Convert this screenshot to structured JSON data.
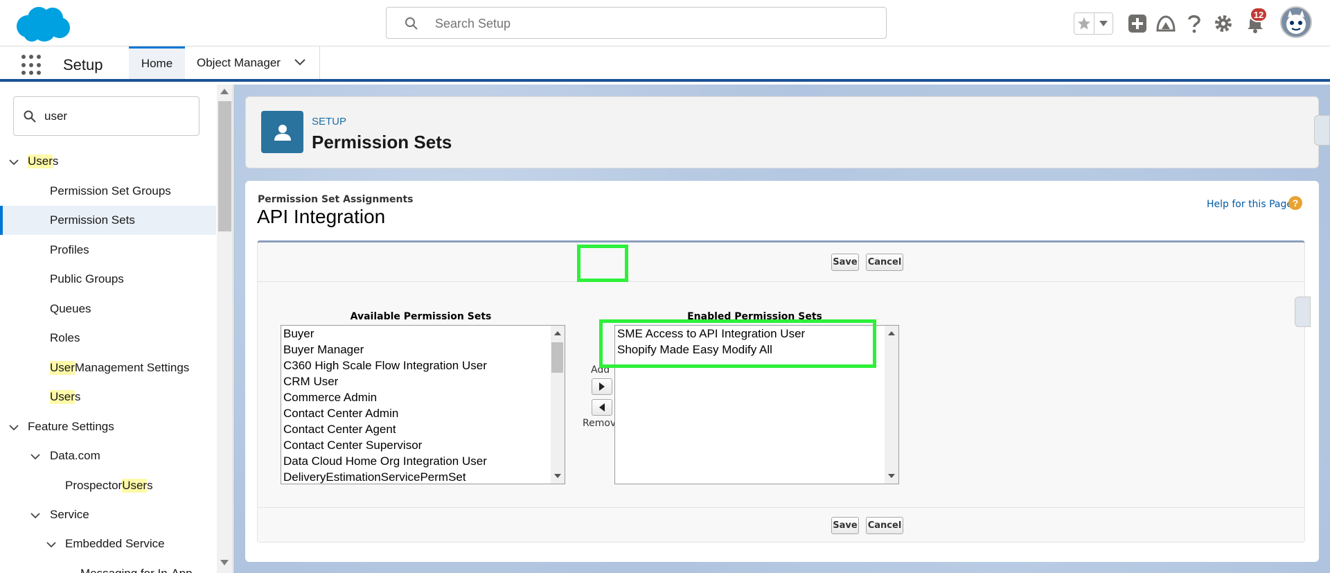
{
  "header": {
    "search_placeholder": "Search Setup",
    "notification_count": "12"
  },
  "context_bar": {
    "app_name": "Setup",
    "tabs": [
      {
        "label": "Home"
      },
      {
        "label": "Object Manager"
      }
    ]
  },
  "sidebar": {
    "quick_find_value": "user",
    "items": [
      {
        "label_hl": "User",
        "label_rest": "s"
      },
      {
        "label": "Permission Set Groups"
      },
      {
        "label": "Permission Sets"
      },
      {
        "label": "Profiles"
      },
      {
        "label": "Public Groups"
      },
      {
        "label": "Queues"
      },
      {
        "label": "Roles"
      },
      {
        "label_hl": "User",
        "label_rest": " Management Settings"
      },
      {
        "label_hl": "User",
        "label_rest": "s"
      },
      {
        "label": "Feature Settings"
      },
      {
        "label": "Data.com"
      },
      {
        "label_pre": "Prospector ",
        "label_hl": "User",
        "label_rest": "s"
      },
      {
        "label": "Service"
      },
      {
        "label": "Embedded Service"
      },
      {
        "label": "Messaging for In-App"
      }
    ]
  },
  "page_header": {
    "kicker": "SETUP",
    "title": "Permission Sets"
  },
  "content": {
    "section_label": "Permission Set Assignments",
    "title": "API Integration",
    "help_text": "Help for this Page",
    "help_icon": "?",
    "save_label": "Save",
    "cancel_label": "Cancel",
    "available_title": "Available Permission Sets",
    "enabled_title": "Enabled Permission Sets",
    "add_label": "Add",
    "remove_label": "Remove",
    "available": [
      "Buyer",
      "Buyer Manager",
      "C360 High Scale Flow Integration User",
      "CRM User",
      "Commerce Admin",
      "Contact Center Admin",
      "Contact Center Agent",
      "Contact Center Supervisor",
      "Data Cloud Home Org Integration User",
      "DeliveryEstimationServicePermSet"
    ],
    "enabled": [
      "SME Access to API Integration User",
      "Shopify Made Easy Modify All"
    ]
  },
  "colors": {
    "brand_blue": "#0176d3",
    "highlight_green": "#2df03a",
    "notification_red": "#c23934"
  }
}
